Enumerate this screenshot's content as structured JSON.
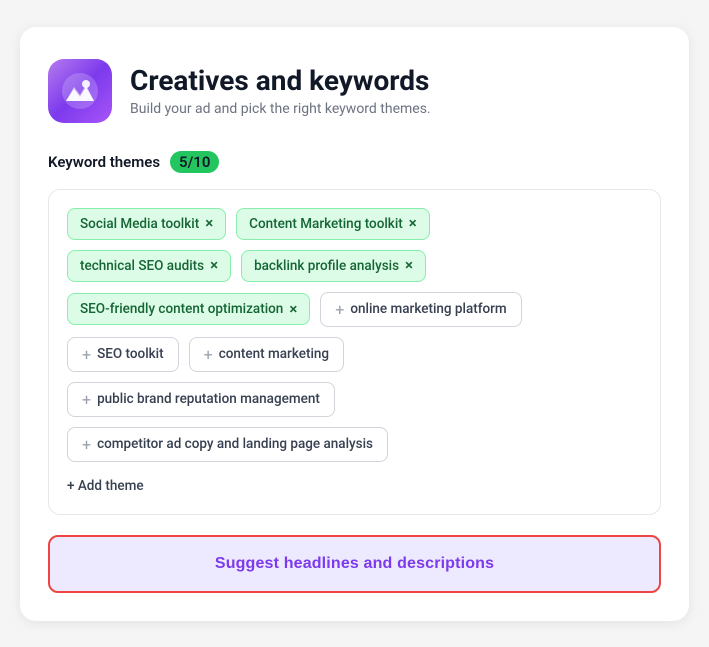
{
  "header": {
    "title": "Creatives and keywords",
    "subtitle": "Build your ad and pick the right keyword themes."
  },
  "keyword_section": {
    "label": "Keyword themes",
    "count_badge": "5/10"
  },
  "selected_tags": [
    {
      "id": "social-media-toolkit",
      "label": "Social Media toolkit"
    },
    {
      "id": "content-marketing-toolkit",
      "label": "Content Marketing toolkit"
    },
    {
      "id": "technical-seo-audits",
      "label": "technical SEO audits"
    },
    {
      "id": "backlink-profile-analysis",
      "label": "backlink profile analysis"
    },
    {
      "id": "seo-friendly-content-optimization",
      "label": "SEO-friendly content optimization"
    }
  ],
  "add_tags": [
    {
      "id": "online-marketing-platform",
      "label": "online marketing platform"
    },
    {
      "id": "seo-toolkit",
      "label": "SEO toolkit"
    },
    {
      "id": "content-marketing",
      "label": "content marketing"
    },
    {
      "id": "public-brand-reputation-management",
      "label": "public brand reputation management"
    },
    {
      "id": "competitor-ad-copy",
      "label": "competitor ad copy and landing page analysis"
    }
  ],
  "add_theme_label": "+ Add theme",
  "suggest_button_label": "Suggest headlines and descriptions",
  "icons": {
    "remove": "×",
    "plus": "+"
  }
}
